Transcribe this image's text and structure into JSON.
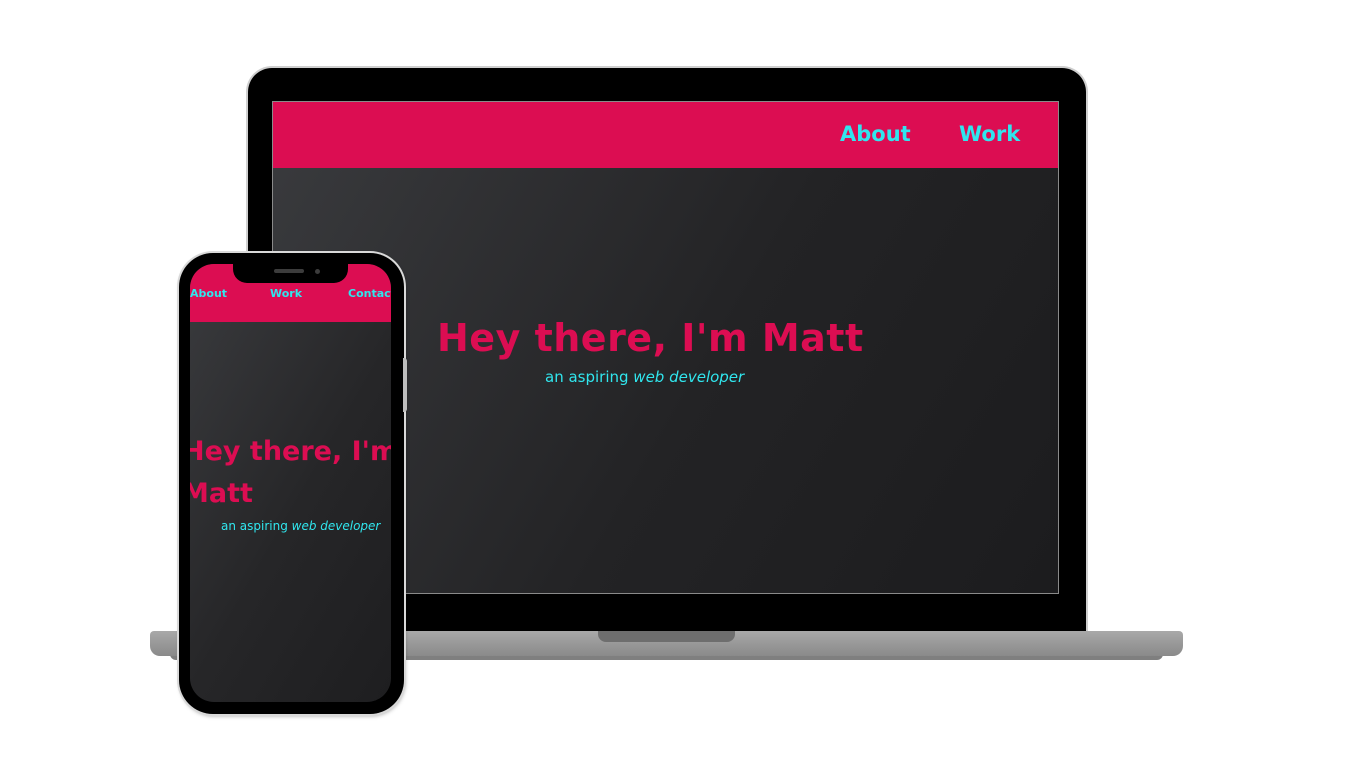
{
  "desktop_site": {
    "nav": {
      "items": [
        {
          "label": "About"
        },
        {
          "label": "Work"
        }
      ]
    },
    "hero": {
      "title": "Hey there, I'm Matt",
      "subtitle_prefix": "an aspiring ",
      "subtitle_emphasis": "web developer"
    }
  },
  "mobile_site": {
    "nav": {
      "items": [
        {
          "label": "About"
        },
        {
          "label": "Work"
        },
        {
          "label": "Contact"
        }
      ]
    },
    "hero": {
      "title_line1": "Hey there, I'm",
      "title_line2": "Matt",
      "subtitle_prefix": "an aspiring ",
      "subtitle_emphasis": "web developer"
    }
  },
  "colors": {
    "brand_pink": "#dc0d52",
    "accent_cyan": "#30e6ee",
    "background_dark": "#232325"
  }
}
